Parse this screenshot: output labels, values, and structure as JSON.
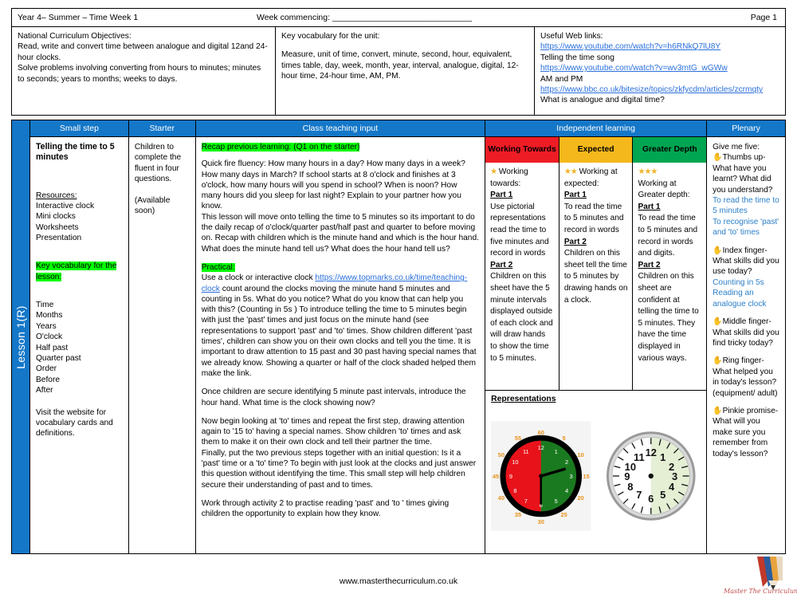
{
  "header": {
    "title": "Year 4– Summer – Time  Week 1",
    "week_commencing_label": "Week commencing: ______________________________",
    "page_label": "Page 1"
  },
  "info": {
    "objectives": {
      "heading": "National Curriculum Objectives:",
      "line1": "Read, write and convert time between analogue and digital 12and 24-hour clocks.",
      "line2": "Solve problems involving converting from hours to minutes; minutes to seconds; years to months; weeks to days."
    },
    "vocabulary": {
      "heading": "Key vocabulary for the unit:",
      "body": "Measure, unit of time, convert, minute, second, hour, equivalent, times table, day, week, month, year, interval, analogue, digital, 12-hour time, 24-hour time, AM, PM."
    },
    "weblinks": {
      "heading": "Useful Web links:",
      "items": [
        {
          "url": "https://www.youtube.com/watch?v=h6RNkQ7lU8Y",
          "caption": "Telling the time song"
        },
        {
          "url": "https://www.youtube.com/watch?v=wv3mtG_wGWw",
          "caption": "AM and PM"
        },
        {
          "url": "https://www.bbc.co.uk/bitesize/topics/zkfycdm/articles/zcrmqty",
          "caption": "What is analogue and digital time?"
        }
      ]
    }
  },
  "lesson_label": "Lesson 1(R)",
  "columns": {
    "small_step": "Small step",
    "starter": "Starter",
    "teaching": "Class teaching input",
    "independent": "Independent learning",
    "plenary": "Plenary"
  },
  "small_step": {
    "title": "Telling the time to 5 minutes",
    "resources_heading": "Resources:",
    "resources": [
      "Interactive clock",
      "Mini clocks",
      "Worksheets",
      "Presentation"
    ],
    "vocab_heading": "Key vocabulary for the lesson:",
    "vocab": [
      "Time",
      "Months",
      "Years",
      "O'clock",
      "Half past",
      "Quarter past",
      "Order",
      "Before",
      "After"
    ],
    "footer_note": "Visit the website for vocabulary cards and definitions."
  },
  "starter": {
    "line1": "Children to complete the fluent in four questions.",
    "line2": "(Available soon)"
  },
  "teaching": {
    "recap_tag": "Recap previous learning: (Q1 on the starter)",
    "para1": "Quick fire fluency: How many hours in a day?  How many days in a week?  How many days in March?  If school starts at 8 o'clock and finishes at 3 o'clock, how many hours will you spend in school?  When is noon?  How many hours did you sleep for last night?  Explain to your partner how you know.",
    "para2": "This lesson will move onto telling the time to 5 minutes so its important to do the daily recap of o'clock/quarter past/half past and quarter to before moving on. Recap with children which is the minute hand and which is the hour hand.  What does the minute hand tell us? What does the hour hand tell us?",
    "practical_tag": "Practical:",
    "practical_pre": "Use a clock or  interactive clock ",
    "practical_link": "https://www.topmarks.co.uk/time/teaching-clock",
    "practical_post": " count around the clocks moving the minute hand  5 minutes and counting in 5s. What do you notice?  What do you know that can help you with this? (Counting in 5s ) To introduce telling the time to 5 minutes begin with just the 'past' times and just focus on the minute hand (see representations to support 'past' and 'to' times.  Show children different 'past times', children can show you on their own clocks and tell you the time. It is important to draw attention to 15 past and 30 past having special names that we already know. Showing a quarter or half of the clock shaded helped them make the link.",
    "para3": "Once children are secure identifying 5 minute past intervals, introduce the hour hand.  What time is the clock showing now?",
    "para4": "Now begin looking at 'to' times and repeat the first step,  drawing attention again to '15 to' having a special names.  Show children 'to' times and ask them to make it on their own clock and tell their partner the time.",
    "para5": "Finally, put the two previous steps together with an initial question: Is it a 'past' time or a 'to' time? To begin with just look at the clocks and just answer this question without identifying the time.  This small step will help children secure their understanding of past and to times.",
    "para6": "Work through activity 2 to practise reading  'past' and 'to ' times giving children the opportunity to explain how they know."
  },
  "independent": {
    "bands": [
      {
        "label": "Working Towards",
        "color": "#ee1c25"
      },
      {
        "label": "Expected",
        "color": "#f5b81c"
      },
      {
        "label": "Greater Depth",
        "color": "#00a651"
      }
    ],
    "working_towards": {
      "stars": "★",
      "intro": "Working towards:",
      "part1_label": "Part 1",
      "part1_text": "Use pictorial representations read the time to five minutes and record in words",
      "part2_label": "Part 2",
      "part2_text": "Children on this sheet have the 5 minute intervals displayed outside of each clock and will draw hands to show the time to 5 minutes."
    },
    "expected": {
      "stars": "★★",
      "intro": "Working at expected:",
      "part1_label": "Part 1",
      "part1_text": "To read the time to 5 minutes and record in words",
      "part2_label": "Part 2",
      "part2_text": "Children on this sheet tell the time to 5 minutes by drawing hands on a clock."
    },
    "greater_depth": {
      "stars": "★★★",
      "intro": "Working at Greater depth:",
      "part1_label": "Part 1",
      "part1_text": "To read the time to 5 minutes and record  in words and digits.",
      "part2_label": "Part 2",
      "part2_text": "Children on this sheet are confident at telling the time to 5 minutes. They have the time displayed in various ways."
    },
    "representations_heading": "Representations"
  },
  "plenary": {
    "intro": "Give me five:",
    "items": [
      {
        "finger": "Thumbs up-",
        "question": "What have you learnt? What did you understand?",
        "answers": [
          "To read the time to 5 minutes",
          "To recognise 'past' and 'to' times"
        ]
      },
      {
        "finger": "Index finger-",
        "question": "What skills did you use today?",
        "answers": [
          "Counting in 5s",
          "Reading an analogue clock"
        ]
      },
      {
        "finger": "Middle finger-",
        "question": "What skills did you find tricky today?",
        "answers": []
      },
      {
        "finger": "Ring finger-",
        "question": "What helped you in today's lesson? (equipment/ adult)",
        "answers": []
      },
      {
        "finger": "Pinkie",
        "question": "promise- What will you make sure you remember from today's lesson?",
        "answers": []
      }
    ]
  },
  "footer": {
    "website": "www.masterthecurriculum.co.uk",
    "wordmark": "Master The Curriculum"
  },
  "clock_left": {
    "minute_marks": [
      "60",
      "5",
      "10",
      "15",
      "20",
      "25",
      "30",
      "35",
      "40",
      "45",
      "50",
      "55"
    ],
    "hour_numbers": [
      "12",
      "1",
      "2",
      "3",
      "4",
      "5",
      "6",
      "7",
      "8",
      "9",
      "10",
      "11"
    ],
    "left_half_color": "#e8121a",
    "right_half_color": "#1a7a1f"
  },
  "clock_right": {
    "hour_numbers": [
      "12",
      "1",
      "2",
      "3",
      "4",
      "5",
      "6",
      "7",
      "8",
      "9",
      "10",
      "11"
    ],
    "right_half_color": "#e4efd4",
    "left_half_color": "#ffffff"
  }
}
